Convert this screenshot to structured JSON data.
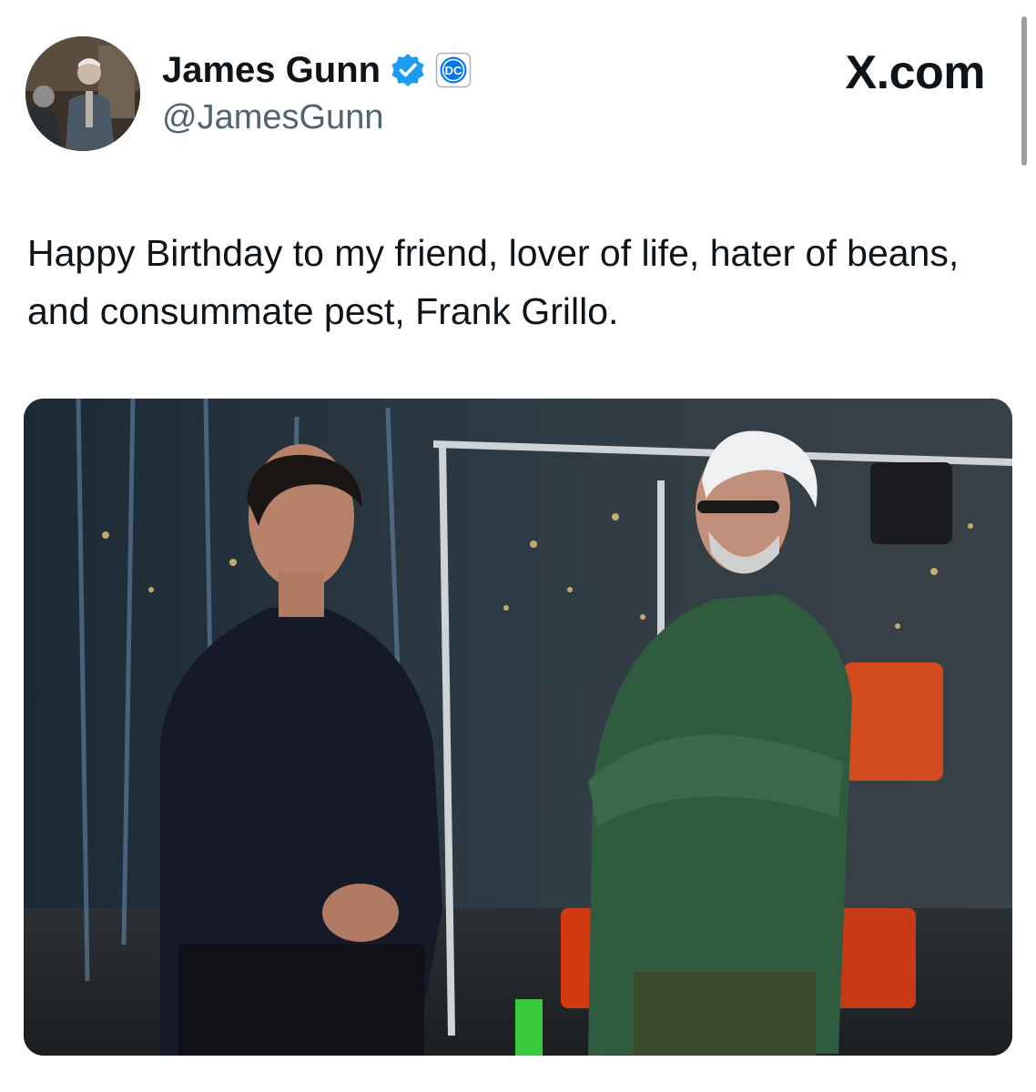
{
  "tweet": {
    "author": {
      "display_name": "James Gunn",
      "handle": "@JamesGunn",
      "verified_icon": "verified-check-icon",
      "affiliate_badge": "dc-logo-badge",
      "affiliate_badge_text": "DC"
    },
    "brand": "X.com",
    "text": "Happy Birthday to my friend, lover of life, hater of beans, and consummate pest, Frank Grillo.",
    "media": {
      "type": "photo"
    }
  },
  "colors": {
    "verified_blue": "#1d9bf0",
    "dc_blue": "#0476f2",
    "text_primary": "#0f1419",
    "text_secondary": "#536471"
  }
}
